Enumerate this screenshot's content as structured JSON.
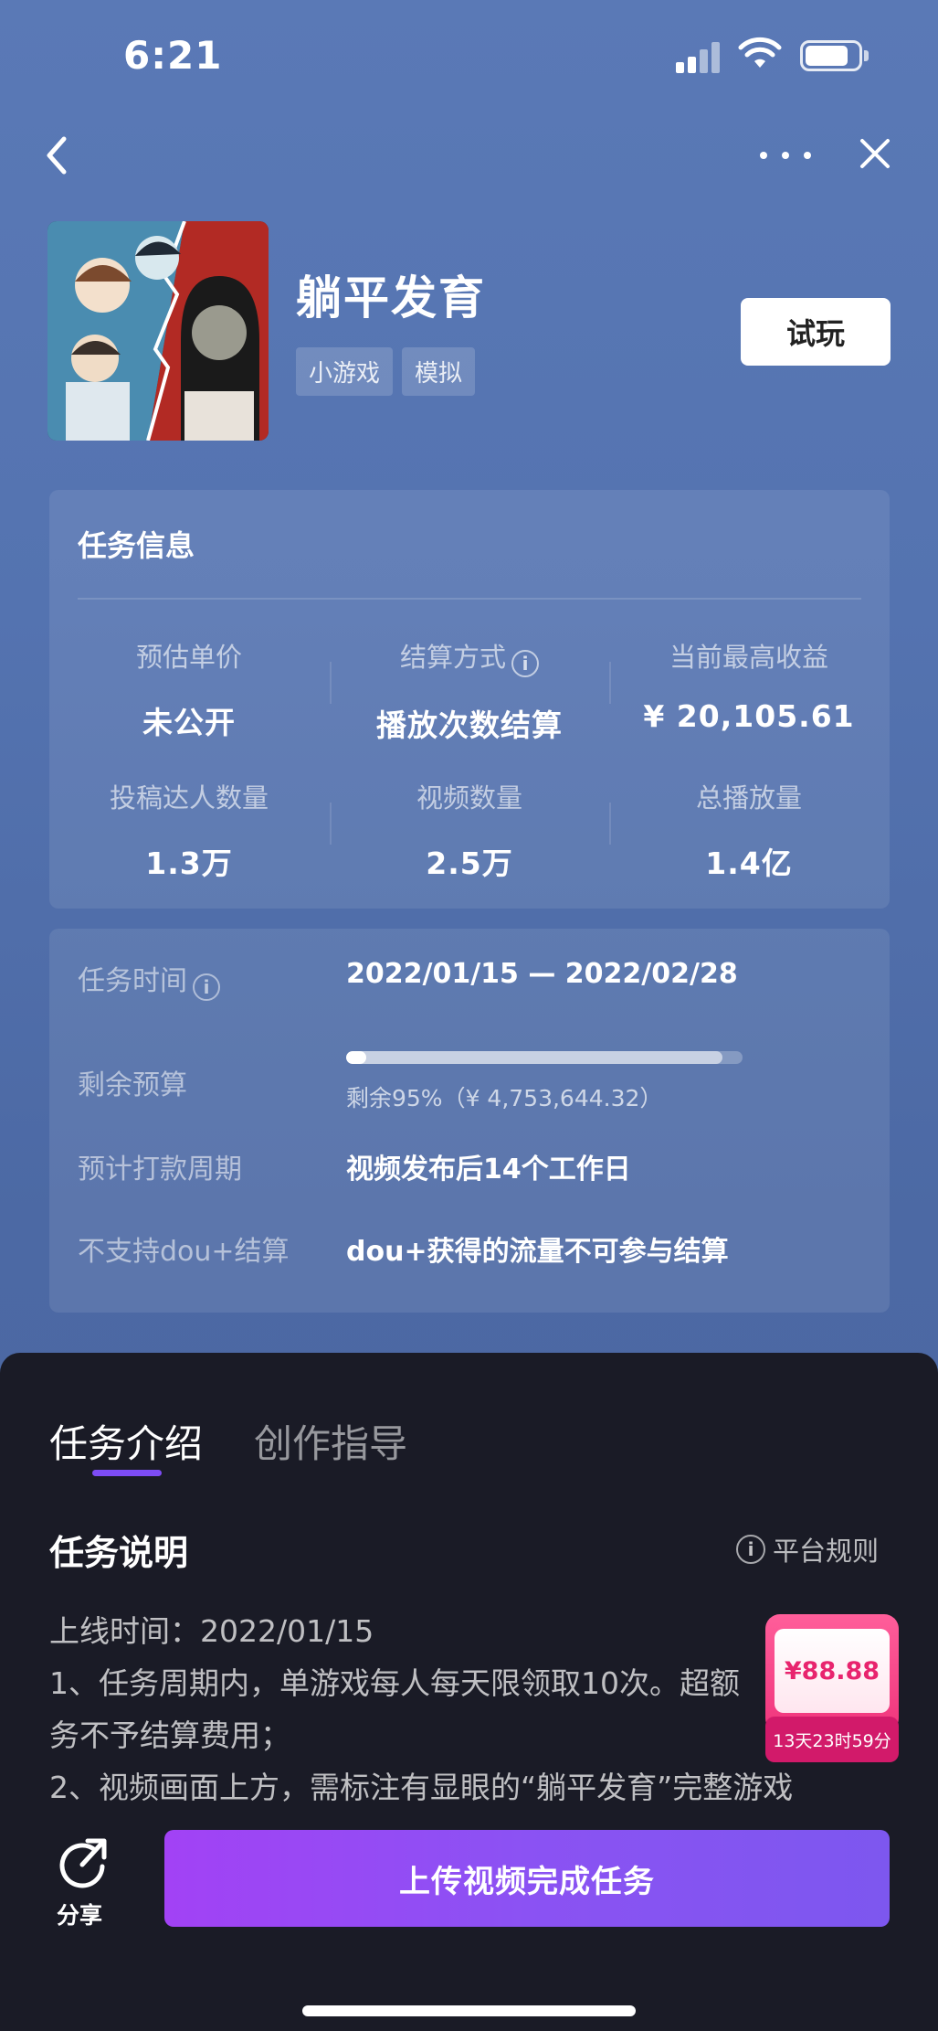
{
  "status_bar": {
    "time": "6:21"
  },
  "game": {
    "title": "躺平发育",
    "tags": [
      "小游戏",
      "模拟"
    ],
    "try_label": "试玩"
  },
  "task_info": {
    "title": "任务信息",
    "stats": [
      {
        "label": "预估单价",
        "value": "未公开"
      },
      {
        "label": "结算方式",
        "value": "播放次数结算"
      },
      {
        "label": "当前最高收益",
        "value": "¥ 20,105.61"
      },
      {
        "label": "投稿达人数量",
        "value": "1.3万"
      },
      {
        "label": "视频数量",
        "value": "2.5万"
      },
      {
        "label": "总播放量",
        "value": "1.4亿"
      }
    ]
  },
  "details": {
    "task_time_label": "任务时间",
    "task_time_value": "2022/01/15 — 2022/02/28",
    "budget_label": "剩余预算",
    "budget_remaining_fraction": 0.95,
    "budget_text": "剩余95%（¥ 4,753,644.32）",
    "payout_label": "预计打款周期",
    "payout_value": "视频发布后14个工作日",
    "dou_label": "不支持dou+结算",
    "dou_value": "dou+获得的流量不可参与结算"
  },
  "sheet": {
    "tabs": [
      {
        "label": "任务介绍",
        "active": true
      },
      {
        "label": "创作指导",
        "active": false
      }
    ],
    "section_title": "任务说明",
    "rules_label": "平台规则",
    "desc_lines": [
      "上线时间：2022/01/15",
      "1、任务周期内，单游戏每人每天限领取10次。超额",
      "务不予结算费用；",
      "2、视频画面上方，需标注有显眼的“躺平发育”完整游戏"
    ]
  },
  "coupon": {
    "amount": "¥88.88",
    "timer": "13天23时59分"
  },
  "bottom": {
    "share_label": "分享",
    "upload_label": "上传视频完成任务"
  },
  "colors": {
    "accent": "#7d4cf5",
    "button_start": "#a242f5",
    "coupon_pink": "#f0357c"
  }
}
